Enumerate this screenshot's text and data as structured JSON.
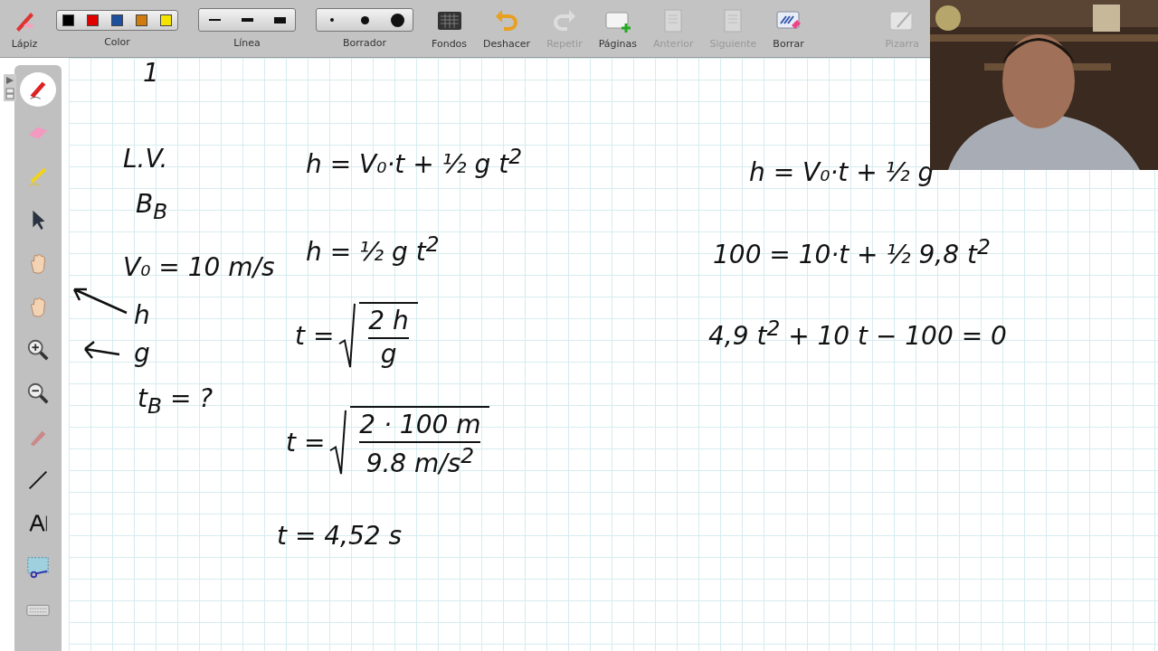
{
  "toolbar": {
    "pen": {
      "label": "Lápiz"
    },
    "color": {
      "label": "Color",
      "swatches": [
        {
          "color": "#000000",
          "selected": false
        },
        {
          "color": "#e00000",
          "selected": false
        },
        {
          "color": "#1c4f9c",
          "selected": false
        },
        {
          "color": "#d07b10",
          "selected": false
        },
        {
          "color": "#f5e400",
          "selected": false
        }
      ]
    },
    "line": {
      "label": "Línea",
      "widths": [
        {
          "kind": "thin",
          "selected": false
        },
        {
          "kind": "medium",
          "selected": false
        },
        {
          "kind": "thick",
          "selected": false
        }
      ]
    },
    "eraser": {
      "label": "Borrador",
      "sizes": [
        {
          "kind": "small",
          "selected": false
        },
        {
          "kind": "medium",
          "selected": false
        },
        {
          "kind": "large",
          "selected": false
        }
      ]
    },
    "buttons": [
      {
        "kind": "backgrounds",
        "label": "Fondos",
        "disabled": false
      },
      {
        "kind": "undo",
        "label": "Deshacer",
        "disabled": false
      },
      {
        "kind": "redo",
        "label": "Repetir",
        "disabled": true
      },
      {
        "kind": "pages",
        "label": "Páginas",
        "disabled": false
      },
      {
        "kind": "previous",
        "label": "Anterior",
        "disabled": true
      },
      {
        "kind": "next",
        "label": "Siguiente",
        "disabled": true
      },
      {
        "kind": "clear",
        "label": "Borrar",
        "disabled": false
      },
      {
        "kind": "whiteboard",
        "label": "Pizarra",
        "disabled": true
      }
    ]
  },
  "tools": [
    {
      "kind": "pen",
      "selected": true
    },
    {
      "kind": "eraser",
      "selected": false
    },
    {
      "kind": "highlighter",
      "selected": false
    },
    {
      "kind": "pointer",
      "selected": false
    },
    {
      "kind": "tap",
      "selected": false
    },
    {
      "kind": "hand",
      "selected": false
    },
    {
      "kind": "zoom-in",
      "selected": false
    },
    {
      "kind": "zoom-out",
      "selected": false
    },
    {
      "kind": "laser",
      "selected": false
    },
    {
      "kind": "line",
      "selected": false
    },
    {
      "kind": "text",
      "selected": false
    },
    {
      "kind": "cut",
      "selected": false
    },
    {
      "kind": "keyboard",
      "selected": false
    }
  ],
  "board": {
    "notes": [
      {
        "kind": "line",
        "text": "1"
      },
      {
        "kind": "line",
        "text": "L.V."
      },
      {
        "kind": "line",
        "text": "B$_{B}$"
      },
      {
        "kind": "line",
        "text": "V₀ = 10 m/s"
      },
      {
        "kind": "line",
        "text": "h"
      },
      {
        "kind": "line",
        "text": "g"
      },
      {
        "kind": "line",
        "text": "t$_{B}$ = ?"
      },
      {
        "kind": "line",
        "text": "h = V₀·t + ½ g t$^{2}$"
      },
      {
        "kind": "line",
        "text": "h = ½ g t$^{2}$"
      },
      {
        "kind": "root",
        "lead": "t =",
        "numerator": "2 h",
        "denominator": "g"
      },
      {
        "kind": "root",
        "lead": "t =",
        "numerator": "2 · 100 m",
        "denominator": "9.8 m/s$^{2}$"
      },
      {
        "kind": "line",
        "text": "t = 4,52 s"
      },
      {
        "kind": "line",
        "text": "h = V₀·t + ½ g"
      },
      {
        "kind": "line",
        "text": "100 = 10·t + ½ 9,8 t$^{2}$"
      },
      {
        "kind": "line",
        "text": "4,9 t$^{2}$ + 10 t − 100 = 0"
      }
    ]
  }
}
